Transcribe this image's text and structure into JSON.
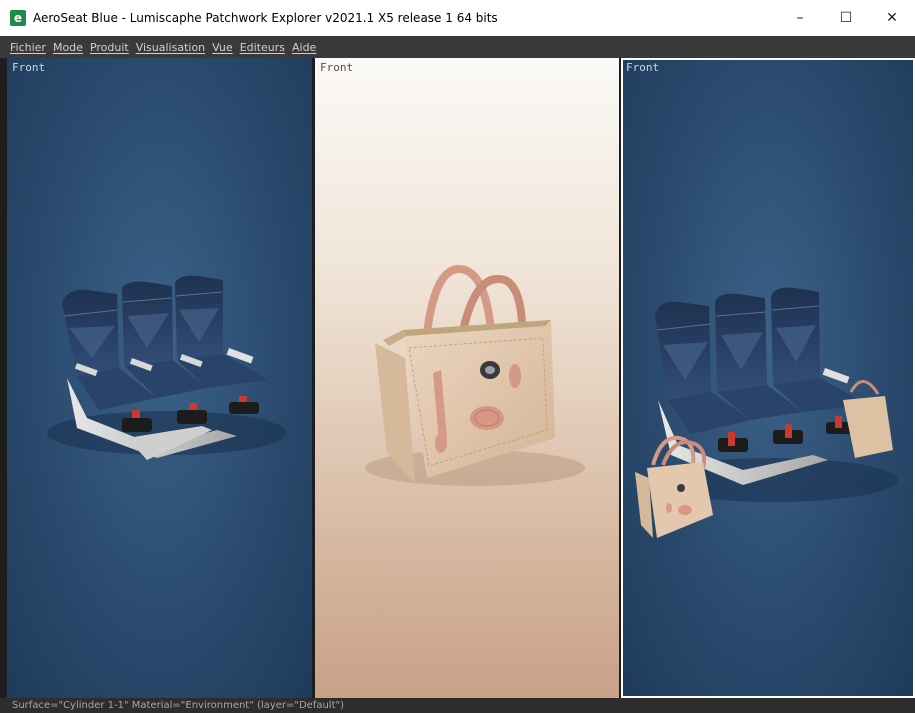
{
  "window": {
    "title": "AeroSeat Blue - Lumiscaphe Patchwork Explorer v2021.1 X5 release 1 64 bits",
    "app_icon_glyph": "e",
    "controls": {
      "minimize": "–",
      "maximize": "☐",
      "close": "✕"
    }
  },
  "menu": [
    {
      "label": "Fichier"
    },
    {
      "label": "Mode"
    },
    {
      "label": "Produit"
    },
    {
      "label": "Visualisation"
    },
    {
      "label": "Vue"
    },
    {
      "label": "Editeurs"
    },
    {
      "label": "Aide"
    }
  ],
  "viewports": [
    {
      "label": "Front",
      "content": "seat-row"
    },
    {
      "label": "Front",
      "content": "handbag"
    },
    {
      "label": "Front",
      "content": "seat-row-with-bags",
      "selected": true
    }
  ],
  "status": {
    "text": "Surface=\"Cylinder 1-1\" Material=\"Environment\" (layer=\"Default\")"
  },
  "colors": {
    "viewport_blue": "#2a4b6e",
    "seat_fabric": "#2b4266",
    "seat_belt": "#c83a2e",
    "bag_leather": "#e3c8ad",
    "bag_handle": "#d49a86"
  }
}
